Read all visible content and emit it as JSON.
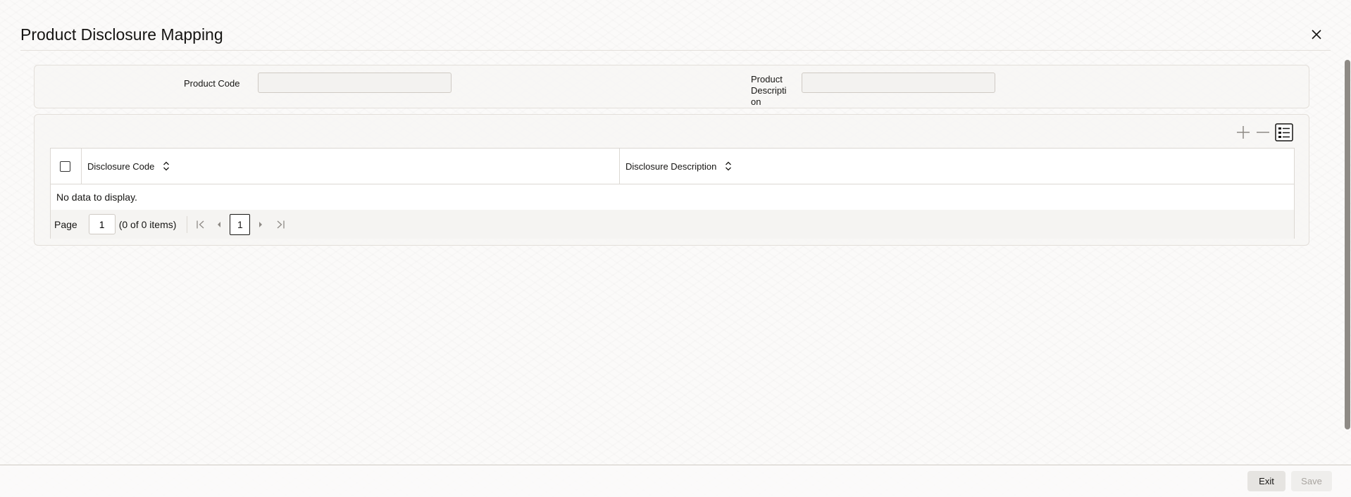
{
  "window": {
    "title": "Product Disclosure Mapping",
    "close_icon": "close-icon"
  },
  "header": {
    "product_code": {
      "label": "Product Code",
      "value": ""
    },
    "product_description": {
      "label_lines": [
        "Product",
        "Descripti",
        "on"
      ],
      "value": ""
    }
  },
  "grid": {
    "toolbar": {
      "add_icon": "plus-icon",
      "remove_icon": "minus-icon",
      "view_icon": "list-view-icon"
    },
    "columns": [
      {
        "label": "Disclosure Code"
      },
      {
        "label": "Disclosure Description"
      }
    ],
    "rows": [],
    "empty_message": "No data to display.",
    "pager": {
      "page_label": "Page",
      "page_value": "1",
      "count_text": "(0 of 0 items)",
      "current_page": "1"
    }
  },
  "footer": {
    "exit_label": "Exit",
    "save_label": "Save"
  },
  "colors": {
    "text": "#161513",
    "border": "#dcd8d3",
    "disabled_text": "#a8a49f"
  }
}
